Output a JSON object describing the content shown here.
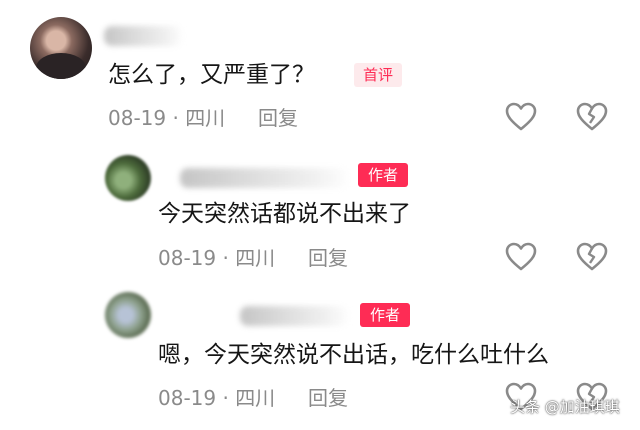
{
  "comments": [
    {
      "text": "怎么了，又严重了？",
      "badge": "首评",
      "meta": "08-19 · 四川",
      "reply": "回复"
    },
    {
      "text": "今天突然话都说不出来了",
      "badge": "作者",
      "meta": "08-19 · 四川",
      "reply": "回复"
    },
    {
      "text": "嗯，今天突然说不出话，吃什么吐什么",
      "badge": "作者",
      "meta": "08-19 · 四川",
      "reply": "回复"
    }
  ],
  "icons": {
    "like": "heart-outline-icon",
    "dislike": "broken-heart-icon"
  },
  "colors": {
    "accent": "#fe2c55",
    "meta_gray": "#8a8a8a"
  },
  "watermark": "头条 @加油琪琪"
}
